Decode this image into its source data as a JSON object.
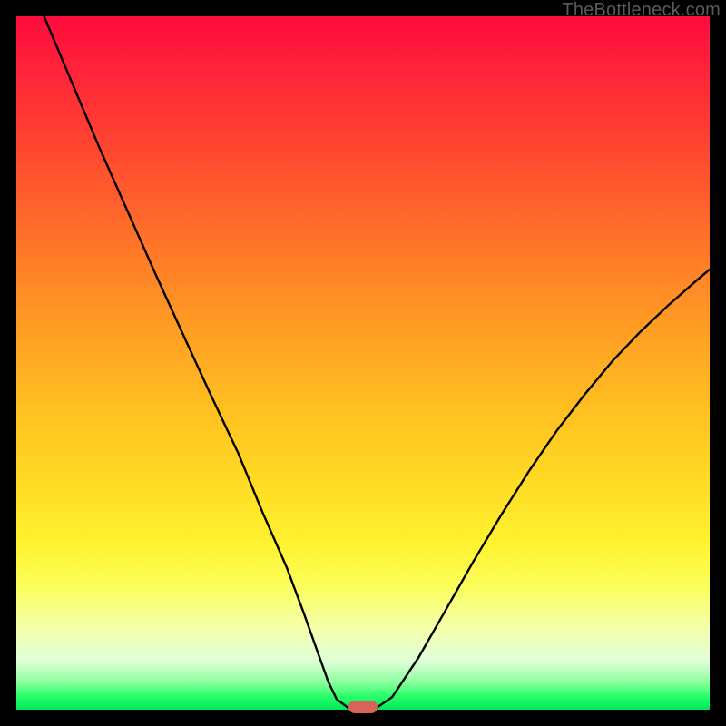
{
  "watermark": "TheBottleneck.com",
  "chart_data": {
    "type": "line",
    "title": "",
    "xlabel": "",
    "ylabel": "",
    "xlim": [
      0,
      1
    ],
    "ylim": [
      0,
      1
    ],
    "grid": false,
    "series": [
      {
        "name": "curve",
        "color": "#000000",
        "x": [
          0.04,
          0.08,
          0.12,
          0.16,
          0.2,
          0.24,
          0.28,
          0.32,
          0.355,
          0.39,
          0.415,
          0.435,
          0.45,
          0.462,
          0.478,
          0.5,
          0.52,
          0.542,
          0.58,
          0.62,
          0.66,
          0.7,
          0.74,
          0.78,
          0.82,
          0.86,
          0.9,
          0.94,
          0.98,
          1.0
        ],
        "y": [
          1.0,
          0.905,
          0.81,
          0.72,
          0.63,
          0.542,
          0.455,
          0.37,
          0.285,
          0.205,
          0.138,
          0.082,
          0.04,
          0.015,
          0.003,
          0.003,
          0.003,
          0.018,
          0.075,
          0.145,
          0.215,
          0.282,
          0.345,
          0.403,
          0.455,
          0.503,
          0.545,
          0.583,
          0.618,
          0.635
        ]
      }
    ],
    "marker": {
      "x": 0.5,
      "y": 0.004,
      "color": "#d9635a",
      "shape": "pill"
    },
    "background": "vertical-gradient-red-to-green"
  }
}
